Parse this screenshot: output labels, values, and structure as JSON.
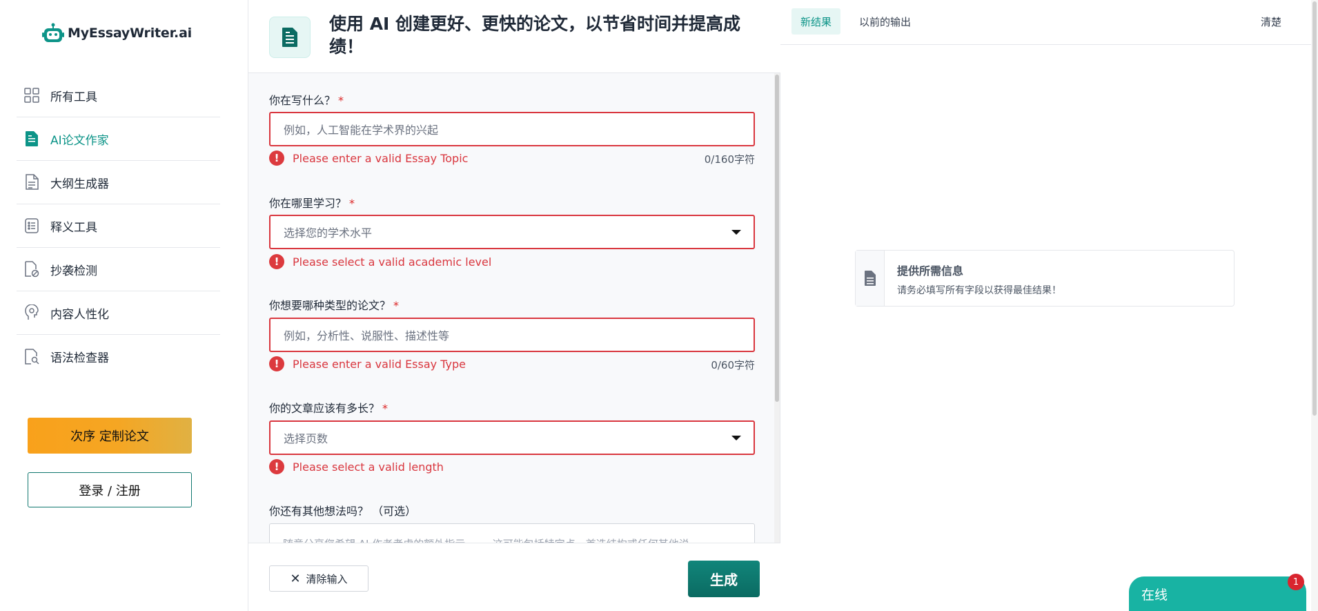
{
  "brand": {
    "name": "MyEssayWriter.ai"
  },
  "sidebar": {
    "items": [
      {
        "label": "所有工具",
        "icon": "grid-icon"
      },
      {
        "label": "AI论文作家",
        "icon": "document-icon",
        "active": true
      },
      {
        "label": "大纲生成器",
        "icon": "outline-icon"
      },
      {
        "label": "释义工具",
        "icon": "list-icon"
      },
      {
        "label": "抄袭检测",
        "icon": "plagiarism-icon"
      },
      {
        "label": "内容人性化",
        "icon": "head-icon"
      },
      {
        "label": "语法检查器",
        "icon": "search-doc-icon"
      }
    ],
    "order_button": "次序 定制论文",
    "login_button": "登录 / 注册"
  },
  "header": {
    "title": "使用 AI 创建更好、更快的论文，以节省时间并提高成绩！"
  },
  "form": {
    "topic": {
      "label": "你在写什么？",
      "required": "*",
      "placeholder": "例如，人工智能在学术界的兴起",
      "error": "Please enter a valid Essay Topic",
      "count": "0/160字符"
    },
    "level": {
      "label": "你在哪里学习？",
      "required": "*",
      "placeholder": "选择您的学术水平",
      "error": "Please select a valid academic level"
    },
    "type": {
      "label": "你想要哪种类型的论文？",
      "required": "*",
      "placeholder": "例如，分析性、说服性、描述性等",
      "error": "Please enter a valid Essay Type",
      "count": "0/60字符"
    },
    "length": {
      "label": "你的文章应该有多长？",
      "required": "*",
      "placeholder": "选择页数",
      "error": "Please select a valid length"
    },
    "extra": {
      "label": "你还有其他想法吗？ （可选）",
      "placeholder": "随意分享您希望 AI 作者考虑的额外指示 —— 这可能包括特定点、首选结构或任何其他说"
    }
  },
  "footer": {
    "clear_label": "清除输入",
    "generate_label": "生成"
  },
  "results": {
    "tab_new": "新结果",
    "tab_previous": "以前的输出",
    "clear": "清楚",
    "info_title": "提供所需信息",
    "info_subtitle": "请务必填写所有字段以获得最佳结果！"
  },
  "chat": {
    "label": "在线",
    "badge": "1"
  },
  "colors": {
    "accent": "#0d9488",
    "error": "#d9363e",
    "order": "#f5a623"
  }
}
